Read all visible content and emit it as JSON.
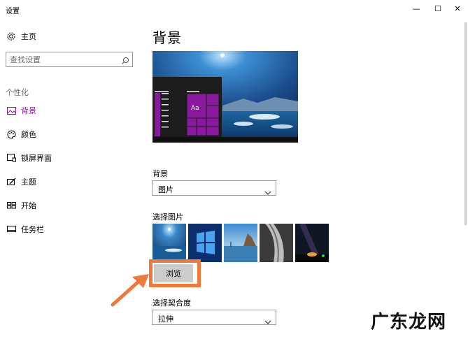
{
  "window": {
    "title": "设置",
    "minimize": "—",
    "maximize": "☐",
    "close": "✕"
  },
  "sidebar": {
    "home_label": "主页",
    "search_placeholder": "查找设置",
    "section_label": "个性化",
    "items": [
      {
        "label": "背景",
        "icon": "picture-icon",
        "active": true
      },
      {
        "label": "颜色",
        "icon": "palette-icon",
        "active": false
      },
      {
        "label": "锁屏界面",
        "icon": "lock-screen-icon",
        "active": false
      },
      {
        "label": "主题",
        "icon": "theme-brush-icon",
        "active": false
      },
      {
        "label": "开始",
        "icon": "start-tiles-icon",
        "active": false
      },
      {
        "label": "任务栏",
        "icon": "taskbar-icon",
        "active": false
      }
    ]
  },
  "main": {
    "title": "背景",
    "preview_tile_label": "Aa",
    "background_label": "背景",
    "background_value": "图片",
    "choose_picture_label": "选择图片",
    "browse_label": "浏览",
    "fit_label": "选择契合度",
    "fit_value": "拉伸"
  },
  "watermark": "广东龙网",
  "colors": {
    "accent": "#8a1a9d",
    "highlight": "#f0783a"
  }
}
